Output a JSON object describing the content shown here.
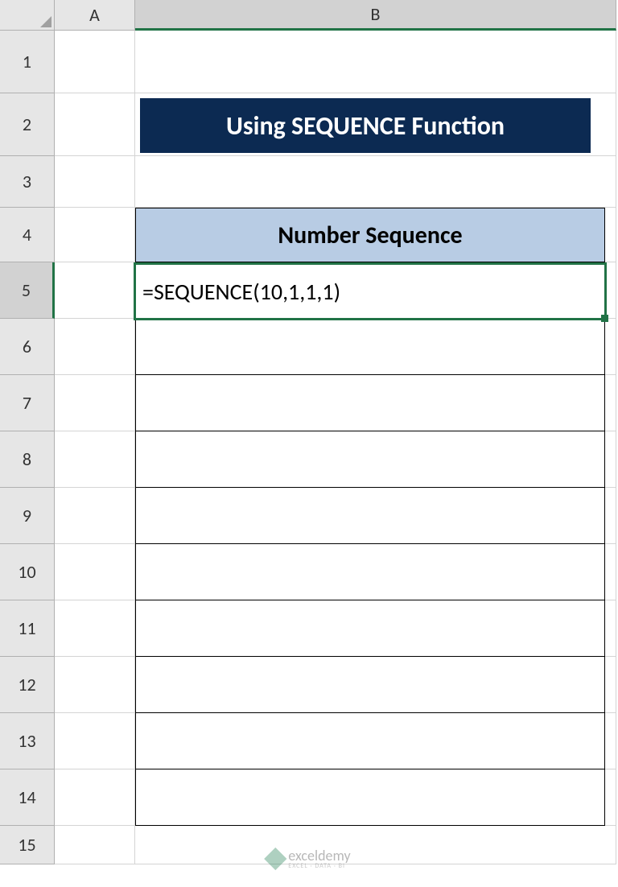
{
  "columns": [
    "A",
    "B"
  ],
  "rows": [
    "1",
    "2",
    "3",
    "4",
    "5",
    "6",
    "7",
    "8",
    "9",
    "10",
    "11",
    "12",
    "13",
    "14",
    "15"
  ],
  "selected_row": "5",
  "selected_col": "B",
  "title": "Using SEQUENCE Function",
  "table_header": "Number Sequence",
  "formula": "=SEQUENCE(10,1,1,1)",
  "watermark": {
    "main": "exceldemy",
    "sub": "EXCEL · DATA · BI"
  }
}
